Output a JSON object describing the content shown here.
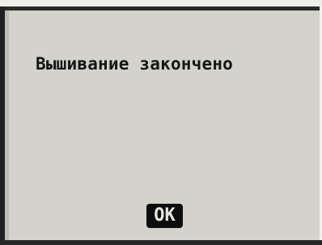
{
  "dialog": {
    "message": "Вышивание закончено",
    "ok_label": "OK"
  },
  "colors": {
    "screen_background": "#d3d3cb",
    "frame": "#202020",
    "button_background": "#0d0d0d",
    "button_text": "#e6e6e0",
    "text": "#151515"
  }
}
